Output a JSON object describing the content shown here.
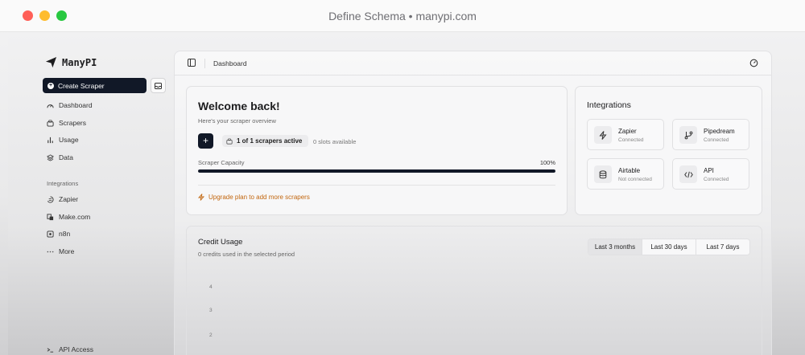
{
  "window": {
    "title": "Define Schema • manypi.com"
  },
  "sidebar": {
    "logo": "ManyPI",
    "create_label": "Create Scraper",
    "nav": [
      {
        "label": "Dashboard",
        "icon": "gauge-icon"
      },
      {
        "label": "Scrapers",
        "icon": "scraper-icon"
      },
      {
        "label": "Usage",
        "icon": "bar-chart-icon"
      },
      {
        "label": "Data",
        "icon": "layers-icon"
      }
    ],
    "integrations_label": "Integrations",
    "integrations": [
      {
        "label": "Zapier",
        "icon": "zapier-icon"
      },
      {
        "label": "Make.com",
        "icon": "make-icon"
      },
      {
        "label": "n8n",
        "icon": "n8n-icon"
      },
      {
        "label": "More",
        "icon": "more-icon"
      }
    ],
    "api_label": "API Access"
  },
  "topbar": {
    "breadcrumb": "Dashboard"
  },
  "welcome": {
    "title": "Welcome back!",
    "subtitle": "Here's your scraper overview",
    "active_text": "1 of 1 scrapers active",
    "slots_text": "0 slots available",
    "capacity_label": "Scraper Capacity",
    "capacity_percent": "100%",
    "capacity_value": 100,
    "upgrade_text": "Upgrade plan to add more scrapers"
  },
  "integrations": {
    "title": "Integrations",
    "items": [
      {
        "name": "Zapier",
        "status": "Connected",
        "icon": "zap-icon"
      },
      {
        "name": "Pipedream",
        "status": "Connected",
        "icon": "pipedream-icon"
      },
      {
        "name": "Airtable",
        "status": "Not connected",
        "icon": "database-icon"
      },
      {
        "name": "API",
        "status": "Connected",
        "icon": "code-icon"
      }
    ]
  },
  "credit": {
    "title": "Credit Usage",
    "subtitle": "0 credits used in the selected period",
    "ranges": [
      "Last 3 months",
      "Last 30 days",
      "Last 7 days"
    ],
    "active_range": "Last 3 months",
    "y_ticks": [
      "4",
      "3",
      "2"
    ]
  },
  "colors": {
    "primary": "#111827",
    "accent": "#c2660e"
  }
}
